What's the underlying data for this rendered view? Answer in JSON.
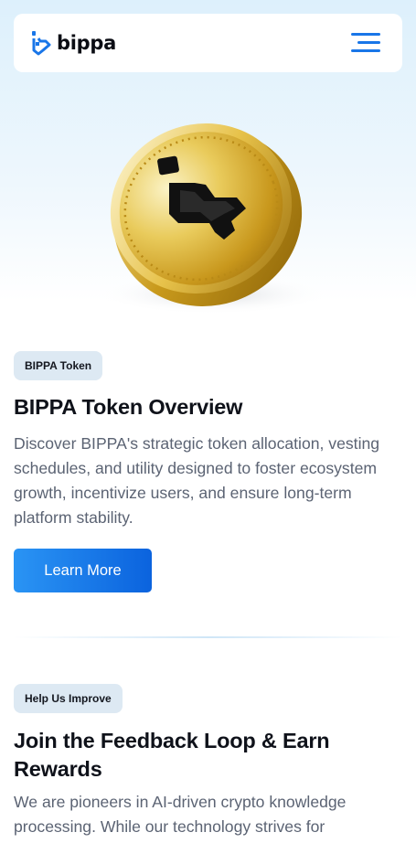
{
  "header": {
    "logo_text": "bippa",
    "logo_icon": "bippa-logo-icon",
    "menu_icon": "hamburger-menu-icon"
  },
  "hero": {
    "image": "gold-bippa-coin"
  },
  "token_section": {
    "badge": "BIPPA Token",
    "title": "BIPPA Token Overview",
    "description": "Discover BIPPA's strategic token allocation, vesting schedules, and utility designed to foster ecosystem growth, incentivize users, and ensure long-term platform stability.",
    "button_label": "Learn More"
  },
  "feedback_section": {
    "badge": "Help Us Improve",
    "title": "Join the Feedback Loop & Earn Rewards",
    "description": "We are pioneers in AI-driven crypto knowledge processing. While our technology strives for"
  },
  "colors": {
    "accent": "#1976e8",
    "button_gradient_start": "#2a94f4",
    "button_gradient_end": "#0b63de",
    "badge_bg": "#dde9f3",
    "gold": "#e8c34a"
  }
}
